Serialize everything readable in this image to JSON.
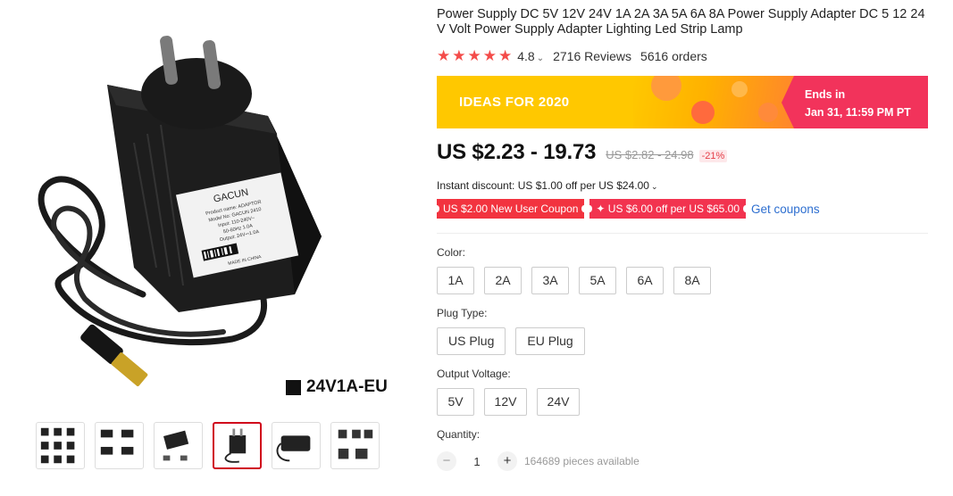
{
  "product": {
    "title": "Power Supply DC 5V 12V 24V 1A 2A 3A 5A 6A 8A Power Supply Adapter DC 5 12 24 V Volt Power Supply Adapter Lighting Led Strip Lamp",
    "rating": "4.8",
    "rating_chevron": "⌄",
    "reviews": "2716 Reviews",
    "orders": "5616 orders",
    "stars": [
      "★",
      "★",
      "★",
      "★",
      "★"
    ]
  },
  "gallery": {
    "variant_caption": "24V1A-EU",
    "label_brand": "GACUN",
    "label_line1": "Product name: ADAPTOR",
    "label_line2": "Model No: GACUN 2410",
    "label_line3": "Input: 110-240V~",
    "label_line4": "50-60Hz 1.0A",
    "label_line5": "Output: 24V⎓1.0A",
    "label_made": "MADE IN CHINA",
    "thumbnails": [
      "thumb-1",
      "thumb-2",
      "thumb-3",
      "thumb-4",
      "thumb-5",
      "thumb-6"
    ],
    "active_thumbnail": 3
  },
  "promo": {
    "text": "IDEAS FOR 2020",
    "ends_label": "Ends in",
    "ends_time": "Jan 31, 11:59 PM PT"
  },
  "price": {
    "current": "US $2.23 - 19.73",
    "original": "US $2.82 - 24.98",
    "discount": "-21%"
  },
  "instant_discount": "Instant discount: US $1.00 off per US $24.00",
  "instant_chevron": "⌄",
  "coupons": {
    "new_user": "US $2.00 New User Coupon",
    "store": "✦ US $6.00 off per US $65.00",
    "get": "Get coupons"
  },
  "sku": {
    "color_label": "Color:",
    "colors": [
      "1A",
      "2A",
      "3A",
      "5A",
      "6A",
      "8A"
    ],
    "plug_label": "Plug Type:",
    "plugs": [
      "US Plug",
      "EU Plug"
    ],
    "voltage_label": "Output Voltage:",
    "voltages": [
      "5V",
      "12V",
      "24V"
    ]
  },
  "quantity": {
    "label": "Quantity:",
    "value": "1",
    "minus": "−",
    "plus": "+",
    "available": "164689 pieces available"
  },
  "colors": {
    "star": "#f44c4a",
    "banner_yellow": "#ffc800",
    "banner_pink": "#f2335b",
    "coupon_red": "#f2333f",
    "link_blue": "#2e6fd0",
    "thumb_active": "#d0021b"
  }
}
